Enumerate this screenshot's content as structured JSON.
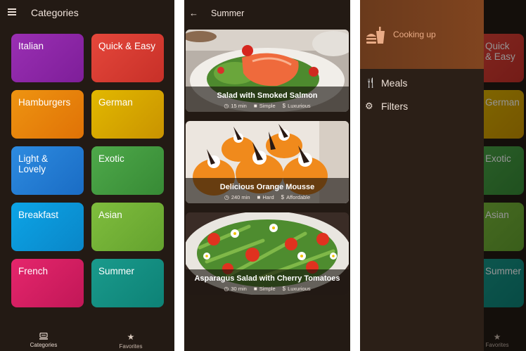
{
  "categories_screen": {
    "title": "Categories",
    "tiles": [
      {
        "label": "Italian",
        "color_from": "#9a2fb3",
        "color_to": "#7e1e99"
      },
      {
        "label": "Quick & Easy",
        "color_from": "#e5473b",
        "color_to": "#c73028"
      },
      {
        "label": "Hamburgers",
        "color_from": "#ee9411",
        "color_to": "#e07206"
      },
      {
        "label": "German",
        "color_from": "#e2b800",
        "color_to": "#c99300"
      },
      {
        "label": "Light & Lovely",
        "color_from": "#2d8be0",
        "color_to": "#1a6cc4"
      },
      {
        "label": "Exotic",
        "color_from": "#4ea94a",
        "color_to": "#378a35"
      },
      {
        "label": "Breakfast",
        "color_from": "#0ca4e6",
        "color_to": "#0a86c8"
      },
      {
        "label": "Asian",
        "color_from": "#7fbd3d",
        "color_to": "#64a22e"
      },
      {
        "label": "French",
        "color_from": "#e5266c",
        "color_to": "#c11757"
      },
      {
        "label": "Summer",
        "color_from": "#1a9a8c",
        "color_to": "#0d8276"
      }
    ],
    "bottom_nav": [
      {
        "label": "Categories",
        "icon": "set-meal-icon",
        "active": true
      },
      {
        "label": "Favorites",
        "icon": "star-icon",
        "active": false
      }
    ]
  },
  "meals_screen": {
    "title": "Summer",
    "meals": [
      {
        "name": "Salad with Smoked Salmon",
        "duration": "15 min",
        "complexity": "Simple",
        "affordability": "Luxurious"
      },
      {
        "name": "Delicious Orange Mousse",
        "duration": "240 min",
        "complexity": "Hard",
        "affordability": "Affordable"
      },
      {
        "name": "Asparagus Salad with Cherry Tomatoes",
        "duration": "30 min",
        "complexity": "Simple",
        "affordability": "Luxurious"
      }
    ]
  },
  "drawer_screen": {
    "header_title": "Cooking up",
    "items": [
      {
        "label": "Meals",
        "icon": "restaurant-icon"
      },
      {
        "label": "Filters",
        "icon": "gear-icon"
      }
    ],
    "behind_tiles": [
      "Quick & Easy",
      "German",
      "Exotic",
      "Asian",
      "Summer"
    ],
    "behind_nav": [
      "Favorites"
    ]
  },
  "colors": {
    "background": "#231a14",
    "drawer_header": "#7a411e",
    "drawer_title": "#e9ab86"
  }
}
